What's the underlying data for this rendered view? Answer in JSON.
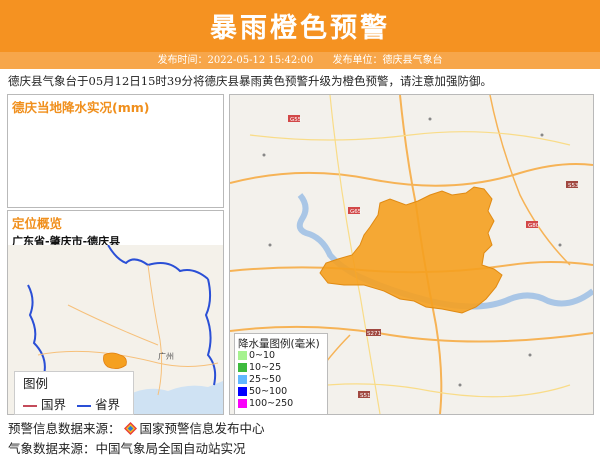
{
  "header": {
    "title": "暴雨橙色预警",
    "publish_time_label": "发布时间：2022-05-12 15:42:00",
    "publisher_label": "发布单位：德庆县气象台"
  },
  "description": "德庆县气象台于05月12日15时39分将德庆县暴雨黄色预警升级为橙色预警，请注意加强防御。",
  "rain_panel": {
    "title": "德庆当地降水实况(mm)"
  },
  "location_panel": {
    "title": "定位概览",
    "region": "广东省-肇庆市-德庆县",
    "map_city_label": "广州",
    "legend": {
      "title": "图例",
      "national_border": "国界",
      "provincial_border": "省界",
      "national_color": "#c44b5a",
      "provincial_color": "#2a4fd6"
    }
  },
  "main_map": {
    "highlight_color": "#f5a020",
    "road_labels": [
      "G55",
      "G65",
      "G80",
      "S53",
      "S51",
      "S271"
    ],
    "rain_legend": {
      "title": "降水量图例(毫米)",
      "items": [
        {
          "label": "0~10",
          "color": "#a6f28f"
        },
        {
          "label": "10~25",
          "color": "#3dba3d"
        },
        {
          "label": "25~50",
          "color": "#61b8ff"
        },
        {
          "label": "50~100",
          "color": "#0000ff"
        },
        {
          "label": "100~250",
          "color": "#fa00fa"
        }
      ]
    }
  },
  "footer": {
    "warning_source": "预警信息数据来源：",
    "warning_source_org": "国家预警信息发布中心",
    "weather_source": "气象数据来源：中国气象局全国自动站实况"
  }
}
